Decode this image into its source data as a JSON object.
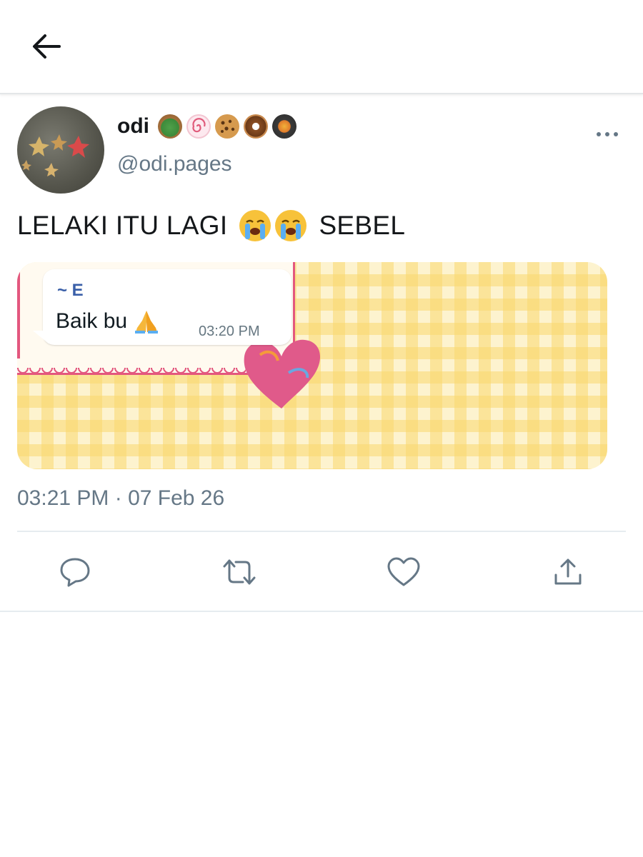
{
  "header": {
    "back_icon": "arrow-left-icon"
  },
  "tweet": {
    "display_name": "odi",
    "name_emojis": [
      "salad-emoji",
      "fish-cake-emoji",
      "cookie-emoji",
      "doughnut-emoji",
      "shallow-pan-emoji"
    ],
    "handle": "@odi.pages",
    "text_before": "LELAKI ITU LAGI",
    "text_emojis": [
      "loudly-crying-face-emoji",
      "loudly-crying-face-emoji"
    ],
    "text_after": "SEBEL",
    "media": {
      "chat_sender": "~ E",
      "chat_message": "Baik bu",
      "chat_message_emoji": "folded-hands-emoji",
      "chat_time": "03:20 PM"
    },
    "timestamp": "03:21 PM · 07 Feb 26"
  },
  "actions": {
    "reply_icon": "reply-icon",
    "retweet_icon": "retweet-icon",
    "like_icon": "heart-icon",
    "share_icon": "share-icon"
  },
  "colors": {
    "text_primary": "#14171a",
    "text_secondary": "#657786",
    "divider": "#e6ecf0",
    "chat_sender": "#3a5fa8"
  }
}
